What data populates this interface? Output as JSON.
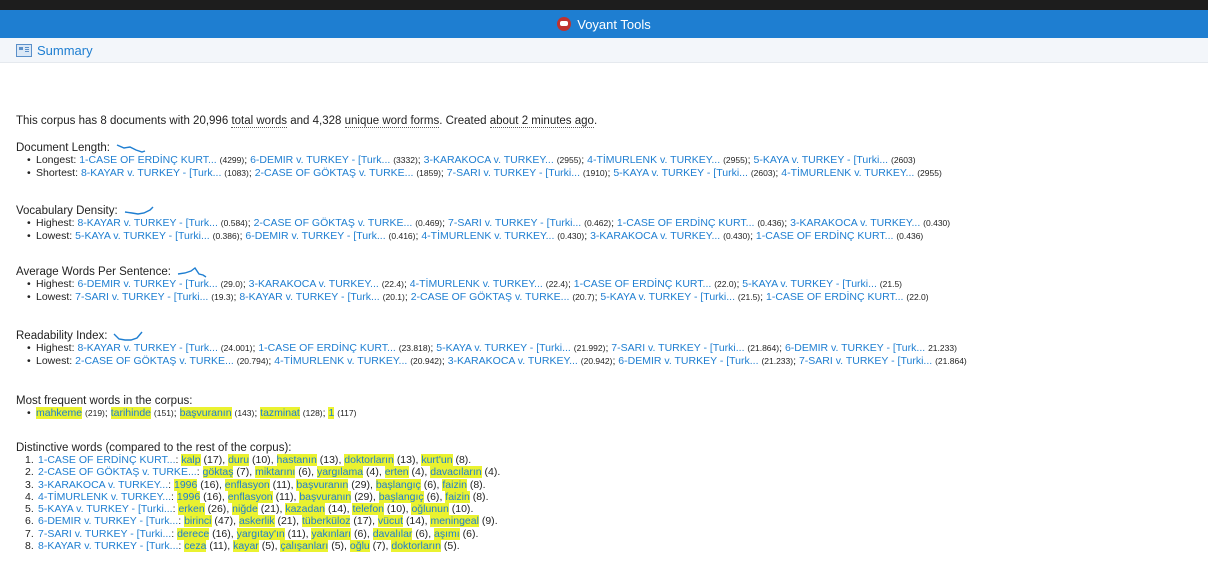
{
  "app": {
    "title": "Voyant Tools",
    "panel_title": "Summary"
  },
  "colors": {
    "accent": "#1e7ed1",
    "highlight": "#eaf230"
  },
  "summary": {
    "pre": "This corpus has 8 documents with 20,996 ",
    "total": "total words",
    "mid": " and 4,328 ",
    "unique": "unique word forms",
    "post": ". Created ",
    "ago": "about 2 minutes ago",
    "end": "."
  },
  "doc_length": {
    "label": "Document Length:",
    "longest": {
      "label": "Longest:",
      "items": [
        {
          "doc": "1-CASE OF ERDİNÇ KURT...",
          "n": "(4299)"
        },
        {
          "doc": "6-DEMIR v. TURKEY - [Turk...",
          "n": "(3332)"
        },
        {
          "doc": "3-KARAKOCA v. TURKEY...",
          "n": "(2955)"
        },
        {
          "doc": "4-TİMURLENK v. TURKEY...",
          "n": "(2955)"
        },
        {
          "doc": "5-KAYA v. TURKEY - [Turki...",
          "n": "(2603)"
        }
      ]
    },
    "shortest": {
      "label": "Shortest:",
      "items": [
        {
          "doc": "8-KAYAR v. TURKEY - [Turk...",
          "n": "(1083)"
        },
        {
          "doc": "2-CASE OF GÖKTAŞ v. TURKE...",
          "n": "(1859)"
        },
        {
          "doc": "7-SARI v. TURKEY - [Turki...",
          "n": "(1910)"
        },
        {
          "doc": "5-KAYA v. TURKEY - [Turki...",
          "n": "(2603)"
        },
        {
          "doc": "4-TİMURLENK v. TURKEY...",
          "n": "(2955)"
        }
      ]
    }
  },
  "vocab": {
    "label": "Vocabulary Density:",
    "highest": {
      "label": "Highest:",
      "items": [
        {
          "doc": "8-KAYAR v. TURKEY - [Turk...",
          "n": "(0.584)"
        },
        {
          "doc": "2-CASE OF GÖKTAŞ v. TURKE...",
          "n": "(0.469)"
        },
        {
          "doc": "7-SARI v. TURKEY - [Turki...",
          "n": "(0.462)"
        },
        {
          "doc": "1-CASE OF ERDİNÇ KURT...",
          "n": "(0.436)"
        },
        {
          "doc": "3-KARAKOCA v. TURKEY...",
          "n": "(0.430)"
        }
      ]
    },
    "lowest": {
      "label": "Lowest:",
      "items": [
        {
          "doc": "5-KAYA v. TURKEY - [Turki...",
          "n": "(0.386)"
        },
        {
          "doc": "6-DEMIR v. TURKEY - [Turk...",
          "n": "(0.416)"
        },
        {
          "doc": "4-TİMURLENK v. TURKEY...",
          "n": "(0.430)"
        },
        {
          "doc": "3-KARAKOCA v. TURKEY...",
          "n": "(0.430)"
        },
        {
          "doc": "1-CASE OF ERDİNÇ KURT...",
          "n": "(0.436)"
        }
      ]
    }
  },
  "avgwords": {
    "label": "Average Words Per Sentence:",
    "highest": {
      "label": "Highest:",
      "items": [
        {
          "doc": "6-DEMIR v. TURKEY - [Turk...",
          "n": "(29.0)"
        },
        {
          "doc": "3-KARAKOCA v. TURKEY...",
          "n": "(22.4)"
        },
        {
          "doc": "4-TİMURLENK v. TURKEY...",
          "n": "(22.4)"
        },
        {
          "doc": "1-CASE OF ERDİNÇ KURT...",
          "n": "(22.0)"
        },
        {
          "doc": "5-KAYA v. TURKEY - [Turki...",
          "n": "(21.5)"
        }
      ]
    },
    "lowest": {
      "label": "Lowest:",
      "items": [
        {
          "doc": "7-SARI v. TURKEY - [Turki...",
          "n": "(19.3)"
        },
        {
          "doc": "8-KAYAR v. TURKEY - [Turk...",
          "n": "(20.1)"
        },
        {
          "doc": "2-CASE OF GÖKTAŞ v. TURKE...",
          "n": "(20.7)"
        },
        {
          "doc": "5-KAYA v. TURKEY - [Turki...",
          "n": "(21.5)"
        },
        {
          "doc": "1-CASE OF ERDİNÇ KURT...",
          "n": "(22.0)"
        }
      ]
    }
  },
  "readability": {
    "label": "Readability Index:",
    "highest": {
      "label": "Highest:",
      "items": [
        {
          "doc": "8-KAYAR v. TURKEY - [Turk...",
          "n": "(24.001)"
        },
        {
          "doc": "1-CASE OF ERDİNÇ KURT...",
          "n": "(23.818)"
        },
        {
          "doc": "5-KAYA v. TURKEY - [Turki...",
          "n": "(21.992)"
        },
        {
          "doc": "7-SARI v. TURKEY - [Turki...",
          "n": "(21.864)"
        },
        {
          "doc": "6-DEMIR v. TURKEY - [Turk...",
          "n": "21.233)"
        }
      ]
    },
    "lowest": {
      "label": "Lowest:",
      "items": [
        {
          "doc": "2-CASE OF GÖKTAŞ v. TURKE...",
          "n": "(20.794)"
        },
        {
          "doc": "4-TİMURLENK v. TURKEY...",
          "n": "(20.942)"
        },
        {
          "doc": "3-KARAKOCA v. TURKEY...",
          "n": "(20.942)"
        },
        {
          "doc": "6-DEMIR v. TURKEY - [Turk...",
          "n": "(21.233)"
        },
        {
          "doc": "7-SARI v. TURKEY - [Turki...",
          "n": "(21.864)"
        }
      ]
    }
  },
  "frequent": {
    "label": "Most frequent words in the corpus:",
    "items": [
      {
        "w": "mahkeme",
        "n": "(219)"
      },
      {
        "w": "tarihinde",
        "n": "(151)"
      },
      {
        "w": "başvuranın",
        "n": "(143)"
      },
      {
        "w": "tazminat",
        "n": "(128)"
      },
      {
        "w": "1",
        "n": "(117)"
      }
    ]
  },
  "distinctive": {
    "label": "Distinctive words (compared to the rest of the corpus):",
    "rows": [
      {
        "num": "1.",
        "doc": "1-CASE OF ERDİNÇ KURT...",
        "words": [
          {
            "w": "kalp",
            "n": "(17)"
          },
          {
            "w": "duru",
            "n": "(10)"
          },
          {
            "w": "hastanın",
            "n": "(13)"
          },
          {
            "w": "doktorların",
            "n": "(13)"
          },
          {
            "w": "kurt'un",
            "n": "(8)"
          }
        ]
      },
      {
        "num": "2.",
        "doc": "2-CASE OF GÖKTAŞ v. TURKE...",
        "words": [
          {
            "w": "göktaş",
            "n": "(7)"
          },
          {
            "w": "miktarını",
            "n": "(6)"
          },
          {
            "w": "yargılama",
            "n": "(4)"
          },
          {
            "w": "erten",
            "n": "(4)"
          },
          {
            "w": "davacıların",
            "n": "(4)"
          }
        ]
      },
      {
        "num": "3.",
        "doc": "3-KARAKOCA v. TURKEY...",
        "words": [
          {
            "w": "1996",
            "n": "(16)"
          },
          {
            "w": "enflasyon",
            "n": "(11)"
          },
          {
            "w": "başvuranın",
            "n": "(29)"
          },
          {
            "w": "başlangıç",
            "n": "(6)"
          },
          {
            "w": "faizin",
            "n": "(8)"
          }
        ]
      },
      {
        "num": "4.",
        "doc": "4-TİMURLENK v. TURKEY...",
        "words": [
          {
            "w": "1996",
            "n": "(16)"
          },
          {
            "w": "enflasyon",
            "n": "(11)"
          },
          {
            "w": "başvuranın",
            "n": "(29)"
          },
          {
            "w": "başlangıç",
            "n": "(6)"
          },
          {
            "w": "faizin",
            "n": "(8)"
          }
        ]
      },
      {
        "num": "5.",
        "doc": "5-KAYA v. TURKEY - [Turki...",
        "words": [
          {
            "w": "erken",
            "n": "(26)"
          },
          {
            "w": "niğde",
            "n": "(21)"
          },
          {
            "w": "kazadan",
            "n": "(14)"
          },
          {
            "w": "telefon",
            "n": "(10)"
          },
          {
            "w": "oğlunun",
            "n": "(10)"
          }
        ]
      },
      {
        "num": "6.",
        "doc": "6-DEMIR v. TURKEY - [Turk...",
        "words": [
          {
            "w": "birinci",
            "n": "(47)"
          },
          {
            "w": "askerlik",
            "n": "(21)"
          },
          {
            "w": "tüberküloz",
            "n": "(17)"
          },
          {
            "w": "vücut",
            "n": "(14)"
          },
          {
            "w": "meningeal",
            "n": "(9)"
          }
        ]
      },
      {
        "num": "7.",
        "doc": "7-SARI v. TURKEY - [Turki...",
        "words": [
          {
            "w": "derece",
            "n": "(16)"
          },
          {
            "w": "yargıtay'ın",
            "n": "(11)"
          },
          {
            "w": "yakınları",
            "n": "(6)"
          },
          {
            "w": "davalılar",
            "n": "(6)"
          },
          {
            "w": "aşımı",
            "n": "(6)"
          }
        ]
      },
      {
        "num": "8.",
        "doc": "8-KAYAR v. TURKEY - [Turk...",
        "words": [
          {
            "w": "ceza",
            "n": "(11)"
          },
          {
            "w": "kayar",
            "n": "(5)"
          },
          {
            "w": "çalışanları",
            "n": "(5)"
          },
          {
            "w": "oğlu",
            "n": "(7)"
          },
          {
            "w": "doktorların",
            "n": "(5)"
          }
        ]
      }
    ]
  }
}
